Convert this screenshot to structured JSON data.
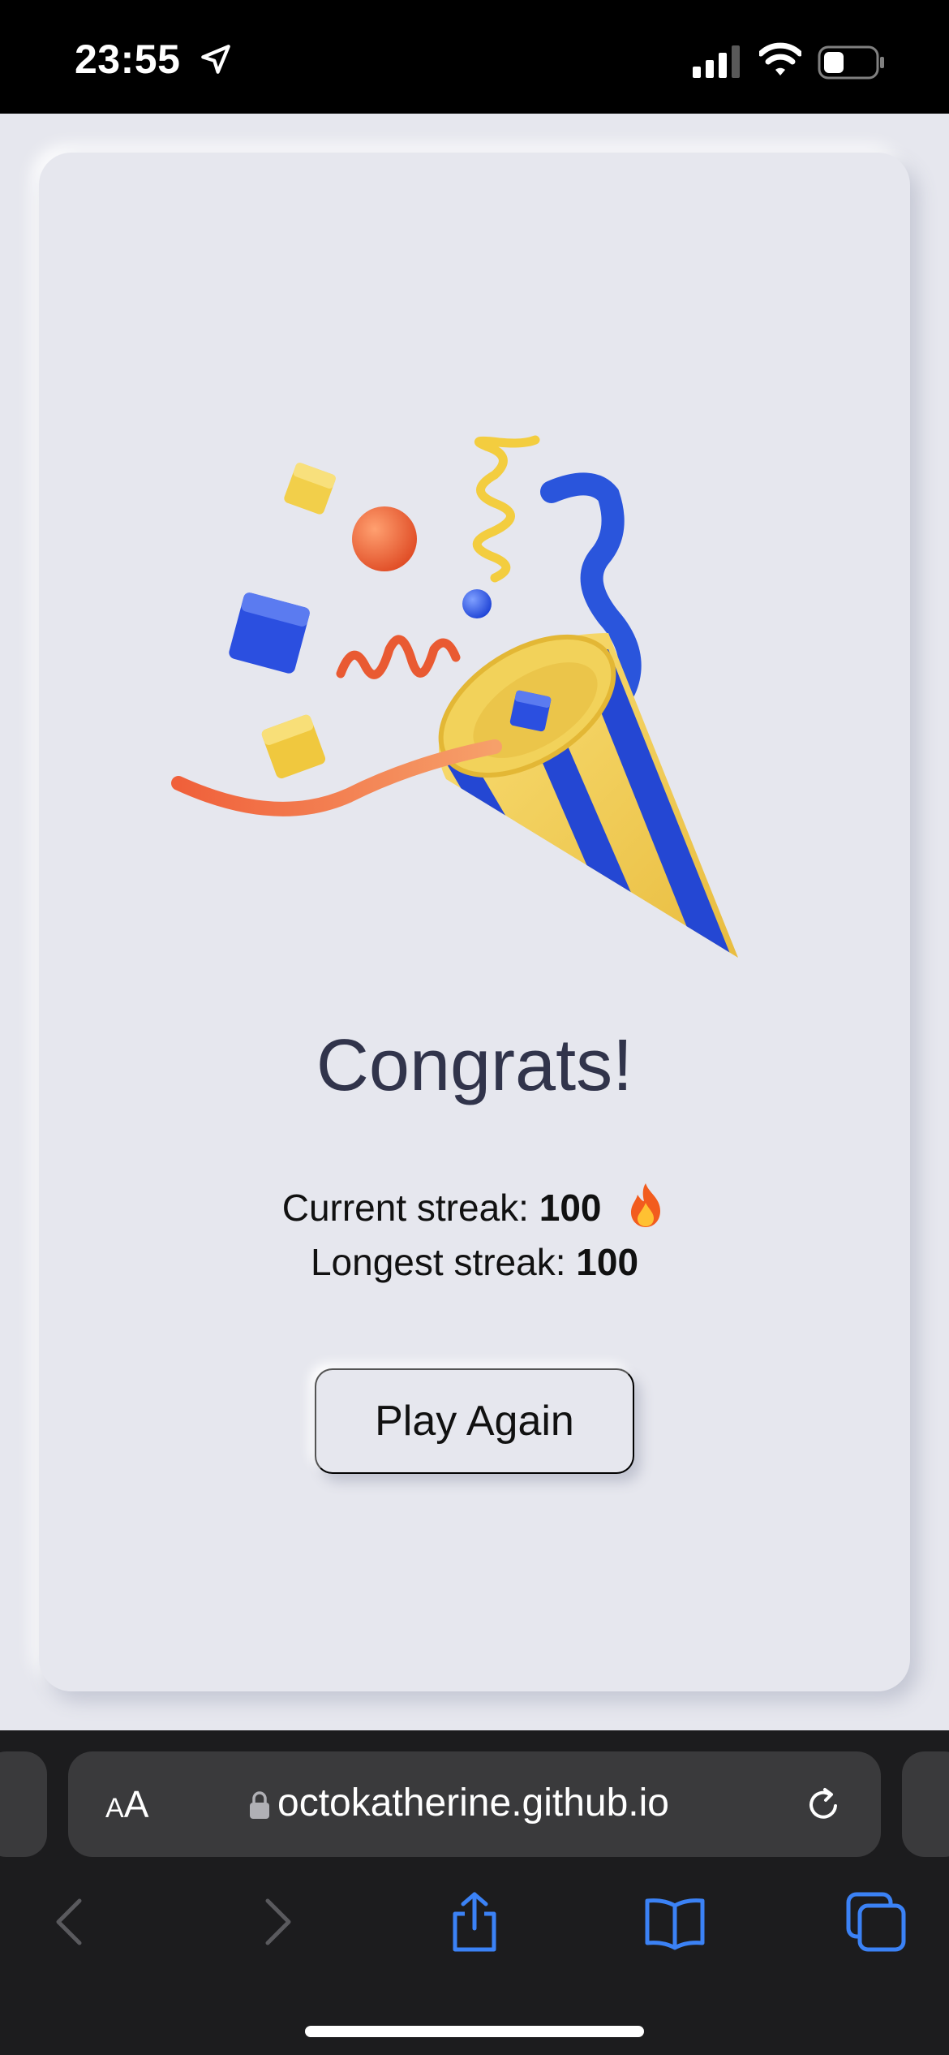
{
  "status_bar": {
    "time": "23:55"
  },
  "content": {
    "title": "Congrats!",
    "current_streak_label": "Current streak:",
    "current_streak_value": "100",
    "longest_streak_label": "Longest streak:",
    "longest_streak_value": "100",
    "play_again_label": "Play Again"
  },
  "browser": {
    "text_size_label_small": "A",
    "text_size_label_large": "A",
    "url": "octokatherine.github.io"
  },
  "colors": {
    "background": "#e6e7ee",
    "text": "#31344b",
    "toolbar_active": "#3b82f6",
    "toolbar_disabled": "#5a5a5e"
  }
}
